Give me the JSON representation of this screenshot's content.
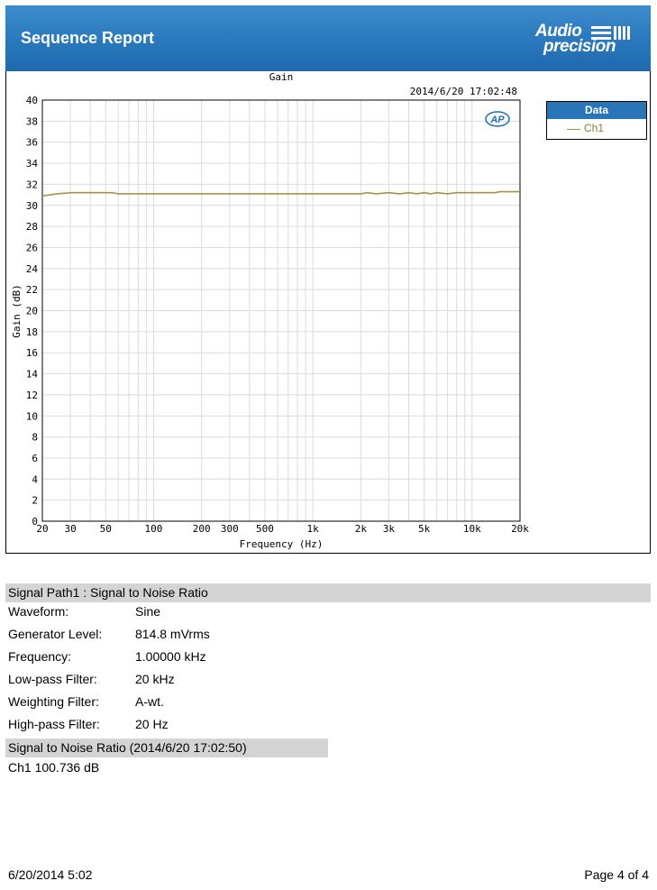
{
  "header": {
    "title": "Sequence Report",
    "logo_line1": "Audio",
    "logo_line2": "precision",
    "background": "#2a78bd"
  },
  "graph": {
    "badge": "AP",
    "timestamp": "2014/6/20 17:02:48",
    "legend": {
      "title": "Data",
      "entries": [
        {
          "label": "Ch1",
          "color": "#a59448"
        }
      ]
    }
  },
  "chart_data": {
    "type": "line",
    "title": "Gain",
    "xlabel": "Frequency (Hz)",
    "ylabel": "Gain (dB)",
    "xscale": "log",
    "xlim": [
      20,
      20000
    ],
    "ylim": [
      0,
      40
    ],
    "yticks": [
      0,
      2,
      4,
      6,
      8,
      10,
      12,
      14,
      16,
      18,
      20,
      22,
      24,
      26,
      28,
      30,
      32,
      34,
      36,
      38,
      40
    ],
    "xticks": [
      {
        "v": 20,
        "label": "20"
      },
      {
        "v": 30,
        "label": "30"
      },
      {
        "v": 50,
        "label": "50"
      },
      {
        "v": 100,
        "label": "100"
      },
      {
        "v": 200,
        "label": "200"
      },
      {
        "v": 300,
        "label": "300"
      },
      {
        "v": 500,
        "label": "500"
      },
      {
        "v": 1000,
        "label": "1k"
      },
      {
        "v": 2000,
        "label": "2k"
      },
      {
        "v": 3000,
        "label": "3k"
      },
      {
        "v": 5000,
        "label": "5k"
      },
      {
        "v": 10000,
        "label": "10k"
      },
      {
        "v": 20000,
        "label": "20k"
      }
    ],
    "grid": true,
    "legend_position": "right",
    "series": [
      {
        "name": "Ch1",
        "color": "#a59448",
        "x": [
          20,
          25,
          30,
          40,
          55,
          60,
          100,
          200,
          500,
          1000,
          2000,
          2200,
          2500,
          3000,
          3500,
          4000,
          4500,
          5000,
          5500,
          6000,
          7000,
          8000,
          9000,
          10000,
          14000,
          15000,
          20000
        ],
        "y": [
          30.9,
          31.1,
          31.2,
          31.2,
          31.2,
          31.1,
          31.1,
          31.1,
          31.1,
          31.1,
          31.1,
          31.2,
          31.1,
          31.2,
          31.1,
          31.2,
          31.1,
          31.2,
          31.1,
          31.2,
          31.1,
          31.2,
          31.2,
          31.2,
          31.2,
          31.3,
          31.3
        ]
      }
    ]
  },
  "measurement": {
    "section_title": "Signal Path1 : Signal to Noise Ratio",
    "rows": [
      {
        "label": "Waveform:",
        "value": "Sine"
      },
      {
        "label": "Generator Level:",
        "value": "814.8 mVrms"
      },
      {
        "label": "Frequency:",
        "value": "1.00000 kHz"
      },
      {
        "label": "Low-pass Filter:",
        "value": "20 kHz"
      },
      {
        "label": "Weighting Filter:",
        "value": "A-wt."
      },
      {
        "label": "High-pass Filter:",
        "value": "20 Hz"
      }
    ],
    "result_title": "Signal to Noise Ratio (2014/6/20 17:02:50)",
    "result_value": "Ch1 100.736 dB"
  },
  "footer": {
    "date": "6/20/2014 5:02",
    "page": "Page 4 of 4"
  }
}
